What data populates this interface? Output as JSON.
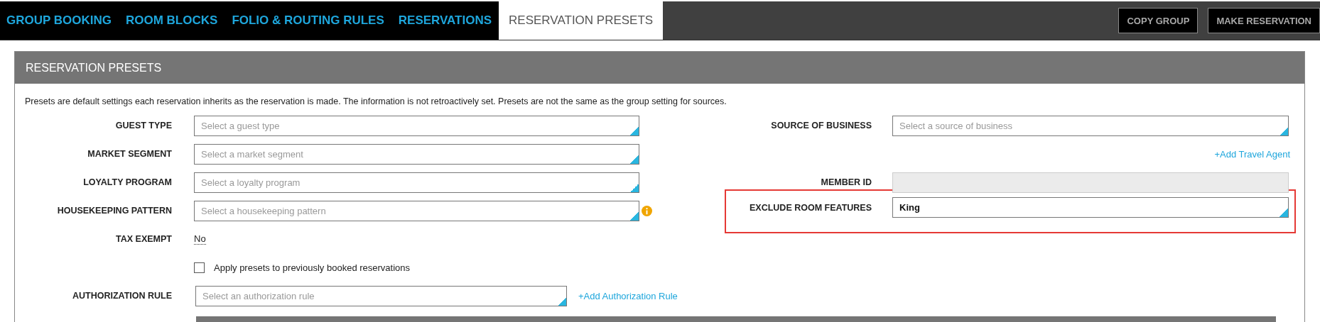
{
  "tabs": [
    {
      "label": "GROUP BOOKING",
      "selected": false
    },
    {
      "label": "ROOM BLOCKS",
      "selected": false
    },
    {
      "label": "FOLIO & ROUTING RULES",
      "selected": false
    },
    {
      "label": "RESERVATIONS",
      "selected": false
    },
    {
      "label": "RESERVATION PRESETS",
      "selected": true
    }
  ],
  "actions": [
    "COPY GROUP",
    "MAKE RESERVATION"
  ],
  "panel": {
    "title": "RESERVATION PRESETS",
    "description": "Presets are default settings each reservation inherits as the reservation is made. The information is not retroactively set. Presets are not the same as the group setting for sources."
  },
  "left_fields": [
    {
      "label": "GUEST TYPE",
      "kind": "select",
      "placeholder": "Select a guest type"
    },
    {
      "label": "MARKET SEGMENT",
      "kind": "select",
      "placeholder": "Select a market segment"
    },
    {
      "label": "LOYALTY PROGRAM",
      "kind": "select",
      "placeholder": "Select a loyalty program"
    },
    {
      "label": "HOUSEKEEPING PATTERN",
      "kind": "select",
      "placeholder": "Select a housekeeping pattern",
      "info": true
    },
    {
      "label": "TAX EXEMPT",
      "kind": "toggle",
      "value": "No"
    }
  ],
  "apply_presets": {
    "label": "Apply presets to previously booked reservations",
    "checked": false
  },
  "authorization": {
    "label": "AUTHORIZATION RULE",
    "placeholder": "Select an authorization rule",
    "link": "+Add Authorization Rule"
  },
  "right_fields": [
    {
      "label": "SOURCE OF BUSINESS",
      "kind": "select",
      "placeholder": "Select a source of business"
    },
    {
      "kind": "link",
      "text": "+Add Travel Agent"
    },
    {
      "label": "MEMBER ID",
      "kind": "text",
      "disabled": true
    },
    {
      "label": "EXCLUDE ROOM FEATURES",
      "kind": "select",
      "value": "King",
      "highlighted": true
    }
  ]
}
